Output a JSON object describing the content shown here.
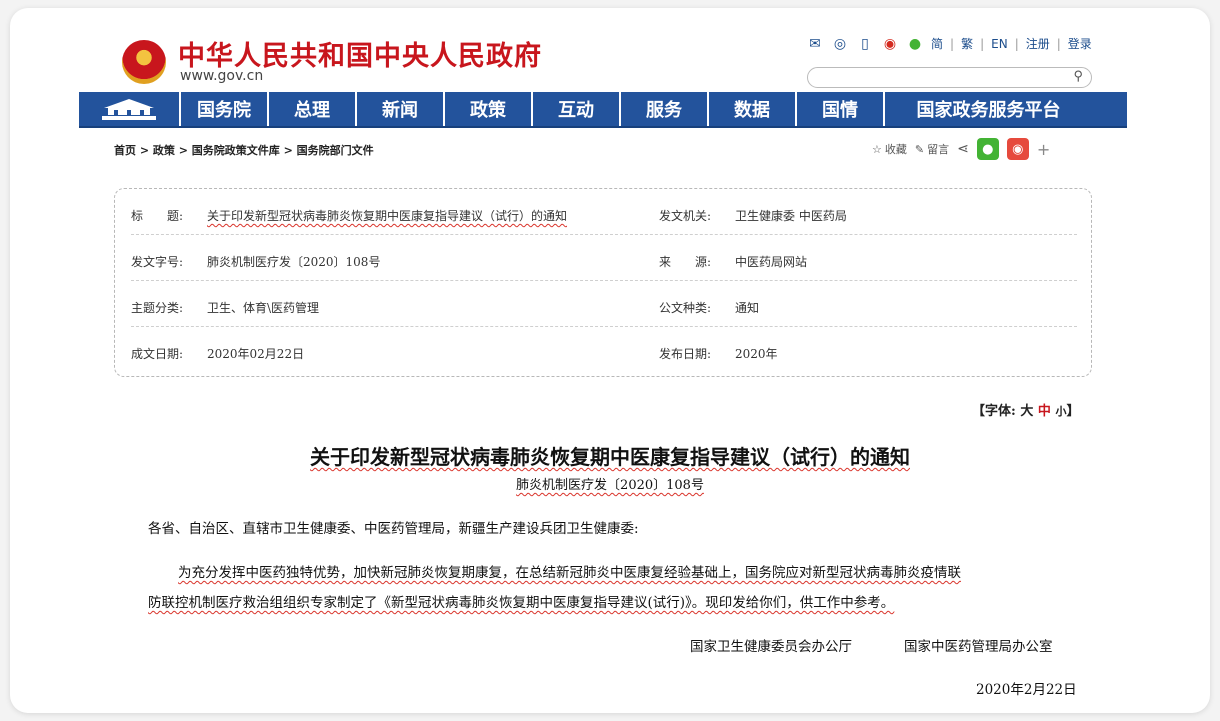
{
  "header": {
    "site_title": "中华人民共和国中央人民政府",
    "site_url": "www.gov.cn",
    "links": [
      "简",
      "繁",
      "EN",
      "注册",
      "登录"
    ],
    "icons": [
      "mail-icon",
      "message-icon",
      "mobile-icon",
      "weibo-icon",
      "wechat-icon"
    ],
    "search_placeholder": ""
  },
  "nav": {
    "items": [
      "国务院",
      "总理",
      "新闻",
      "政策",
      "互动",
      "服务",
      "数据",
      "国情",
      "国家政务服务平台"
    ]
  },
  "breadcrumb": "首页 > 政策 > 国务院政策文件库 > 国务院部门文件",
  "tools": {
    "favorite": "收藏",
    "comment": "留言"
  },
  "meta": {
    "title_label": "标　　题:",
    "title_value": "关于印发新型冠状病毒肺炎恢复期中医康复指导建议（试行）的通知",
    "issuer_label": "发文机关:",
    "issuer_value": "卫生健康委 中医药局",
    "docno_label": "发文字号:",
    "docno_value": "肺炎机制医疗发〔2020〕108号",
    "source_label": "来　　源:",
    "source_value": "中医药局网站",
    "topic_label": "主题分类:",
    "topic_value": "卫生、体育\\医药管理",
    "type_label": "公文种类:",
    "type_value": "通知",
    "written_label": "成文日期:",
    "written_value": "2020年02月22日",
    "published_label": "发布日期:",
    "published_value": "2020年"
  },
  "fontsize": {
    "prefix": "【字体:",
    "large": "大",
    "medium": "中",
    "small": "小",
    "suffix": "】"
  },
  "article": {
    "title": "关于印发新型冠状病毒肺炎恢复期中医康复指导建议（试行）的通知",
    "doc_no": "肺炎机制医疗发〔2020〕108号",
    "salutation": "各省、自治区、直辖市卫生健康委、中医药管理局，新疆生产建设兵团卫生健康委:",
    "body_line1": "为充分发挥中医药独特优势，加快新冠肺炎恢复期康复，在总结新冠肺炎中医康复经验基础上，国务院应对新型冠状病毒肺炎疫情联",
    "body_line2": "防联控机制医疗救治组组织专家制定了《新型冠状病毒肺炎恢复期中医康复指导建议(试行)》。现印发给你们，供工作中参考。",
    "signer1": "国家卫生健康委员会办公厅",
    "signer2": "国家中医药管理局办公室",
    "date": "2020年2月22日"
  }
}
